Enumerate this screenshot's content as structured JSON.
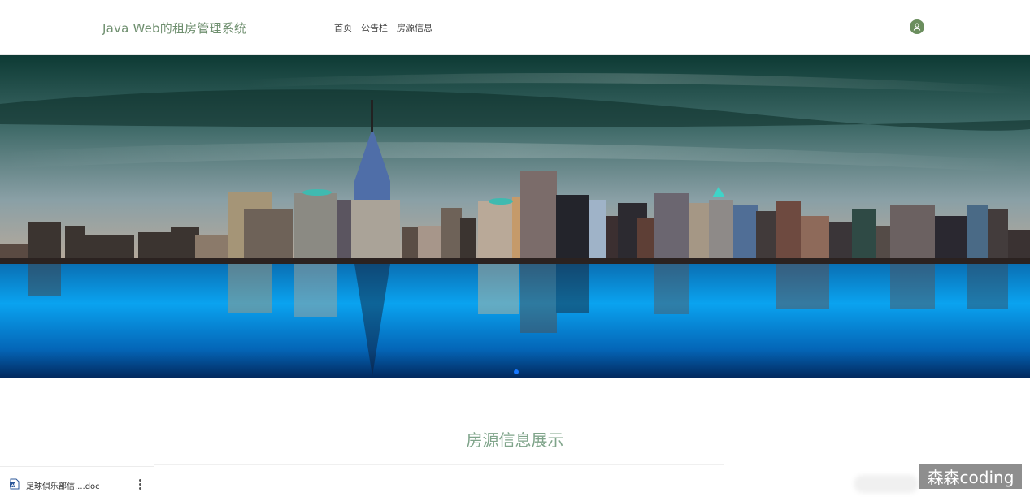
{
  "header": {
    "brand": "Java Web的租房管理系统",
    "nav": [
      "首页",
      "公告栏",
      "房源信息"
    ],
    "avatar_icon": "user-avatar-icon"
  },
  "banner": {
    "image": "city-skyline-reflection",
    "active_slide": 1,
    "indicator_color": "#1677ff"
  },
  "main": {
    "section_title": "房源信息展示"
  },
  "download_bar": {
    "file_name": "足球俱乐部信....doc",
    "file_icon": "word-doc-icon",
    "menu_icon": "more-vertical-icon"
  },
  "watermark": "森森coding",
  "colors": {
    "brand": "#6f8f6f",
    "section_title": "#7fa48a",
    "avatar_bg": "#6b8e5e"
  }
}
